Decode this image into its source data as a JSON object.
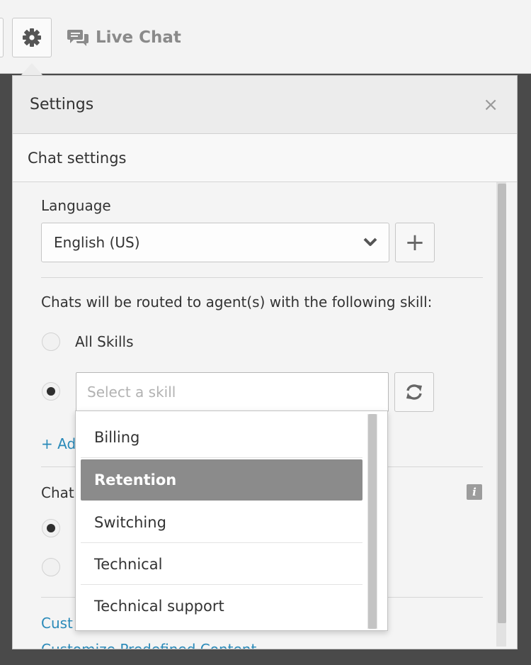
{
  "toolbar": {
    "live_chat_label": "Live Chat"
  },
  "panel": {
    "title": "Settings",
    "close_glyph": "×",
    "section_title": "Chat settings"
  },
  "language": {
    "label": "Language",
    "selected": "English (US)",
    "add_glyph": "+"
  },
  "routing": {
    "label": "Chats will be routed to agent(s) with the following skill:",
    "option_all": "All Skills",
    "skill_placeholder": "Select a skill",
    "add_link_partial": "+ Ad",
    "selected_option": "skill"
  },
  "chat_section": {
    "label_partial": "Chat",
    "info_glyph": "i"
  },
  "links": {
    "customize_1_partial": "Cust",
    "customize_2": "Customize Predefined Content"
  },
  "skill_dropdown": {
    "options": [
      "Billing",
      "Retention",
      "Switching",
      "Technical",
      "Technical support"
    ],
    "highlighted": "Retention"
  },
  "icons": {
    "gear": "gear-icon",
    "chat": "chat-bubbles-icon",
    "chevron": "chevron-down-icon",
    "refresh": "refresh-icon",
    "info": "info-icon",
    "close": "close-icon"
  },
  "colors": {
    "link": "#2a8ab9",
    "highlight": "#8b8b8b",
    "header_bg": "#ececec"
  }
}
